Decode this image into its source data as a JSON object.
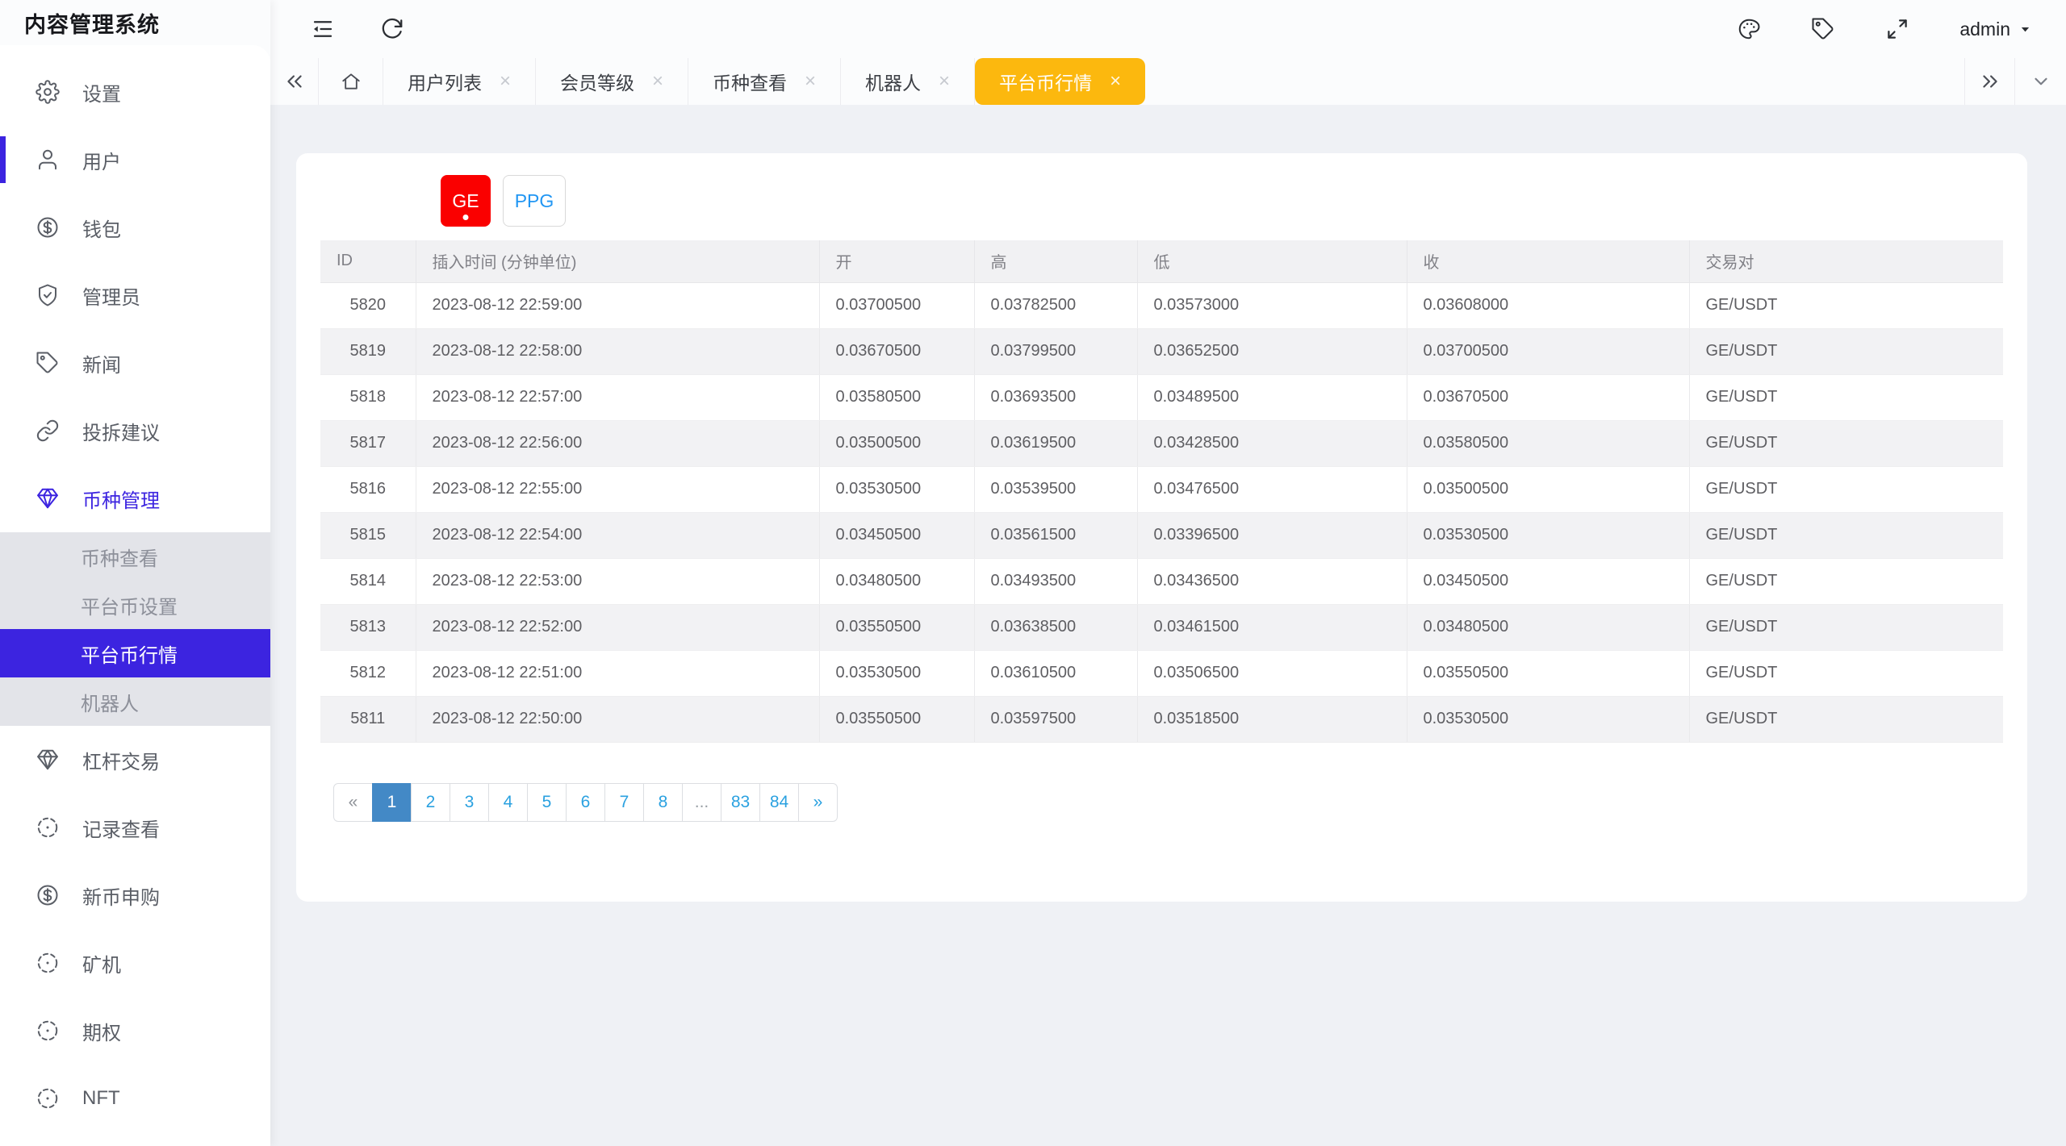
{
  "app": {
    "title": "内容管理系统"
  },
  "header": {
    "user": "admin"
  },
  "sidebar": {
    "items": [
      {
        "name": "settings",
        "label": "设置",
        "icon": "gear"
      },
      {
        "name": "users",
        "label": "用户",
        "icon": "user",
        "indicator": true
      },
      {
        "name": "wallet",
        "label": "钱包",
        "icon": "dollar-circle"
      },
      {
        "name": "admins",
        "label": "管理员",
        "icon": "shield-check"
      },
      {
        "name": "news",
        "label": "新闻",
        "icon": "tag"
      },
      {
        "name": "feedback",
        "label": "投拆建议",
        "icon": "link"
      },
      {
        "name": "coin-management",
        "label": "币种管理",
        "icon": "gem",
        "accent": true,
        "children": [
          {
            "name": "coin-view",
            "label": "币种查看"
          },
          {
            "name": "platform-coin-config",
            "label": "平台币设置"
          },
          {
            "name": "platform-coin-market",
            "label": "平台币行情",
            "active": true
          },
          {
            "name": "robot",
            "label": "机器人"
          }
        ]
      },
      {
        "name": "leverage-trade",
        "label": "杠杆交易",
        "icon": "gem"
      },
      {
        "name": "records",
        "label": "记录查看",
        "icon": "circle-dashed"
      },
      {
        "name": "new-coin-sub",
        "label": "新币申购",
        "icon": "dollar-circle"
      },
      {
        "name": "miner",
        "label": "矿机",
        "icon": "circle-dashed"
      },
      {
        "name": "options",
        "label": "期权",
        "icon": "circle-dashed"
      },
      {
        "name": "nft",
        "label": "NFT",
        "icon": "circle-dashed"
      }
    ]
  },
  "tabs": [
    {
      "name": "user-list",
      "label": "用户列表"
    },
    {
      "name": "member-level",
      "label": "会员等级"
    },
    {
      "name": "coin-view",
      "label": "币种查看"
    },
    {
      "name": "robot",
      "label": "机器人"
    },
    {
      "name": "platform-coin-market",
      "label": "平台币行情",
      "active": true
    }
  ],
  "coins": [
    {
      "label": "GE",
      "active": true
    },
    {
      "label": "PPG",
      "active": false
    }
  ],
  "table": {
    "keys": [
      "id",
      "time",
      "open",
      "high",
      "low",
      "close",
      "pair"
    ],
    "columns": [
      "ID",
      "插入时间 (分钟单位)",
      "开",
      "高",
      "低",
      "收",
      "交易对"
    ],
    "rows": [
      [
        "5820",
        "2023-08-12 22:59:00",
        "0.03700500",
        "0.03782500",
        "0.03573000",
        "0.03608000",
        "GE/USDT"
      ],
      [
        "5819",
        "2023-08-12 22:58:00",
        "0.03670500",
        "0.03799500",
        "0.03652500",
        "0.03700500",
        "GE/USDT"
      ],
      [
        "5818",
        "2023-08-12 22:57:00",
        "0.03580500",
        "0.03693500",
        "0.03489500",
        "0.03670500",
        "GE/USDT"
      ],
      [
        "5817",
        "2023-08-12 22:56:00",
        "0.03500500",
        "0.03619500",
        "0.03428500",
        "0.03580500",
        "GE/USDT"
      ],
      [
        "5816",
        "2023-08-12 22:55:00",
        "0.03530500",
        "0.03539500",
        "0.03476500",
        "0.03500500",
        "GE/USDT"
      ],
      [
        "5815",
        "2023-08-12 22:54:00",
        "0.03450500",
        "0.03561500",
        "0.03396500",
        "0.03530500",
        "GE/USDT"
      ],
      [
        "5814",
        "2023-08-12 22:53:00",
        "0.03480500",
        "0.03493500",
        "0.03436500",
        "0.03450500",
        "GE/USDT"
      ],
      [
        "5813",
        "2023-08-12 22:52:00",
        "0.03550500",
        "0.03638500",
        "0.03461500",
        "0.03480500",
        "GE/USDT"
      ],
      [
        "5812",
        "2023-08-12 22:51:00",
        "0.03530500",
        "0.03610500",
        "0.03506500",
        "0.03550500",
        "GE/USDT"
      ],
      [
        "5811",
        "2023-08-12 22:50:00",
        "0.03550500",
        "0.03597500",
        "0.03518500",
        "0.03530500",
        "GE/USDT"
      ]
    ]
  },
  "pagination": {
    "pages": [
      "«",
      "1",
      "2",
      "3",
      "4",
      "5",
      "6",
      "7",
      "8",
      "...",
      "83",
      "84",
      "»"
    ],
    "active": "1"
  },
  "colors": {
    "accent_purple": "#3C24E0",
    "tab_active_yellow": "#FCB80E",
    "coin_active_red": "#FA0000",
    "link_blue": "#2196F3",
    "pagination_active_blue": "#4389C6"
  }
}
